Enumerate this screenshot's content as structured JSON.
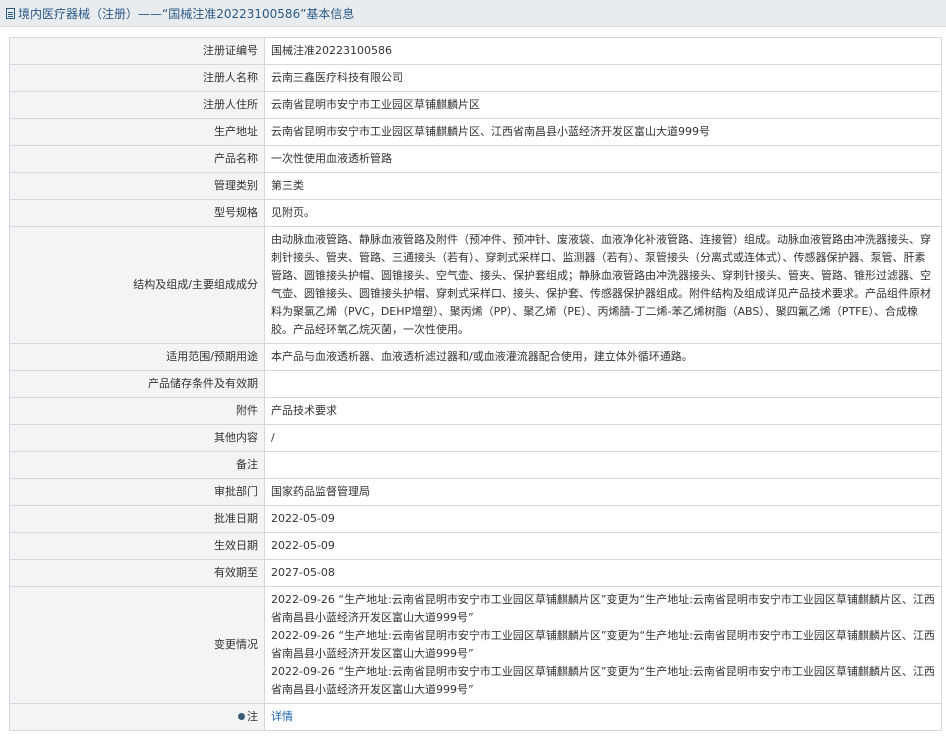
{
  "header": {
    "icon": "document-icon",
    "title": "境内医疗器械（注册）——“国械注准20223100586”基本信息"
  },
  "rows": {
    "reg_no": {
      "label": "注册证编号",
      "value": "国械注准20223100586"
    },
    "registrant": {
      "label": "注册人名称",
      "value": "云南三鑫医疗科技有限公司"
    },
    "registrant_address": {
      "label": "注册人住所",
      "value": "云南省昆明市安宁市工业园区草铺麒麟片区"
    },
    "production_address": {
      "label": "生产地址",
      "value": "云南省昆明市安宁市工业园区草铺麒麟片区、江西省南昌县小蓝经济开发区富山大道999号"
    },
    "product_name": {
      "label": "产品名称",
      "value": "一次性使用血液透析管路"
    },
    "category": {
      "label": "管理类别",
      "value": "第三类"
    },
    "model": {
      "label": "型号规格",
      "value": "见附页。"
    },
    "composition": {
      "label": "结构及组成/主要组成成分",
      "value": "由动脉血液管路、静脉血液管路及附件（预冲件、预冲针、废液袋、血液净化补液管路、连接管）组成。动脉血液管路由冲洗器接头、穿刺针接头、管夹、管路、三通接头（若有）、穿刺式采样口、监测器（若有）、泵管接头（分离式或连体式）、传感器保护器、泵管、肝素管路、圆锥接头护帽、圆锥接头、空气壶、接头、保护套组成；静脉血液管路由冲洗器接头、穿刺针接头、管夹、管路、锥形过滤器、空气壶、圆锥接头、圆锥接头护帽、穿刺式采样口、接头、保护套、传感器保护器组成。附件结构及组成详见产品技术要求。产品组件原材料为聚氯乙烯（PVC，DEHP增塑）、聚丙烯（PP）、聚乙烯（PE）、丙烯腈-丁二烯-苯乙烯树脂（ABS）、聚四氟乙烯（PTFE）、合成橡胶。产品经环氧乙烷灭菌，一次性使用。"
    },
    "scope": {
      "label": "适用范围/预期用途",
      "value": "本产品与血液透析器、血液透析滤过器和/或血液灌流器配合使用，建立体外循环通路。"
    },
    "storage": {
      "label": "产品储存条件及有效期",
      "value": ""
    },
    "attachment": {
      "label": "附件",
      "value": "产品技术要求"
    },
    "other": {
      "label": "其他内容",
      "value": "/"
    },
    "remarks": {
      "label": "备注",
      "value": ""
    },
    "approval_dept": {
      "label": "审批部门",
      "value": "国家药品监督管理局"
    },
    "approval_date": {
      "label": "批准日期",
      "value": "2022-05-09"
    },
    "effective_date": {
      "label": "生效日期",
      "value": "2022-05-09"
    },
    "expiry_date": {
      "label": "有效期至",
      "value": "2027-05-08"
    },
    "changes": {
      "label": "变更情况",
      "entries": [
        "2022-09-26 “生产地址:云南省昆明市安宁市工业园区草铺麒麟片区”变更为“生产地址:云南省昆明市安宁市工业园区草铺麒麟片区、江西省南昌县小蓝经济开发区富山大道999号”",
        "2022-09-26 “生产地址:云南省昆明市安宁市工业园区草铺麒麟片区”变更为“生产地址:云南省昆明市安宁市工业园区草铺麒麟片区、江西省南昌县小蓝经济开发区富山大道999号”",
        "2022-09-26 “生产地址:云南省昆明市安宁市工业园区草铺麒麟片区”变更为“生产地址:云南省昆明市安宁市工业园区草铺麒麟片区、江西省南昌县小蓝经济开发区富山大道999号”"
      ]
    },
    "note": {
      "label": "注",
      "icon": "map-pin-icon",
      "link": "详情"
    }
  }
}
